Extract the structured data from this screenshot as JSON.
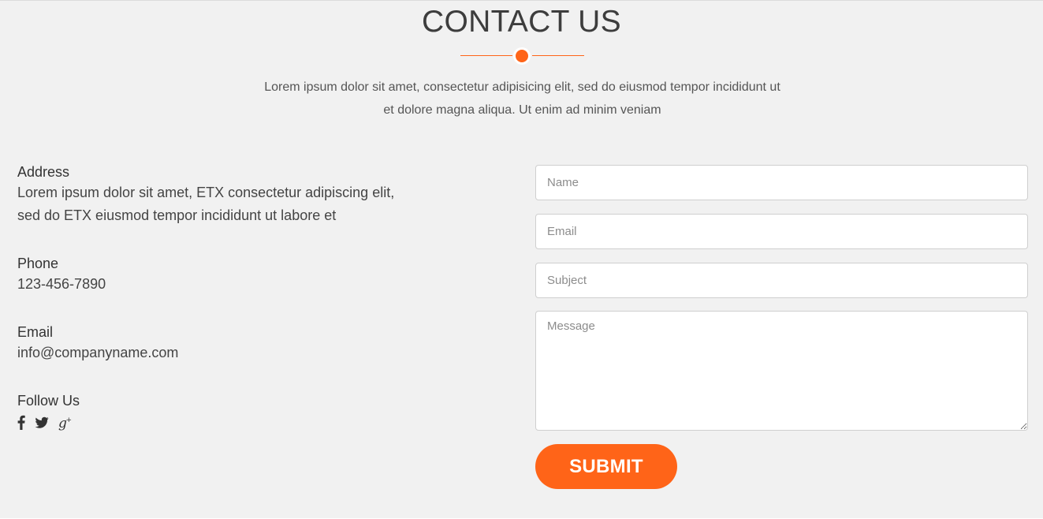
{
  "section": {
    "title": "CONTACT US",
    "intro_line1": "Lorem ipsum dolor sit amet, consectetur adipisicing elit, sed do eiusmod tempor incididunt ut",
    "intro_line2": "et dolore magna aliqua. Ut enim ad minim veniam",
    "accent_color": "#ff6418",
    "background_color": "#f1f1f1"
  },
  "info": {
    "address_label": "Address",
    "address_line1": "Lorem ipsum dolor sit amet, ETX consectetur adipiscing elit,",
    "address_line2": "sed do ETX eiusmod tempor incididunt ut labore et",
    "phone_label": "Phone",
    "phone_value": "123-456-7890",
    "email_label": "Email",
    "email_value": "info@companyname.com",
    "follow_label": "Follow Us",
    "social_icons": [
      "facebook-icon",
      "twitter-icon",
      "google-plus-icon"
    ]
  },
  "form": {
    "name_placeholder": "Name",
    "email_placeholder": "Email",
    "subject_placeholder": "Subject",
    "message_placeholder": "Message",
    "submit_label": "SUBMIT"
  }
}
